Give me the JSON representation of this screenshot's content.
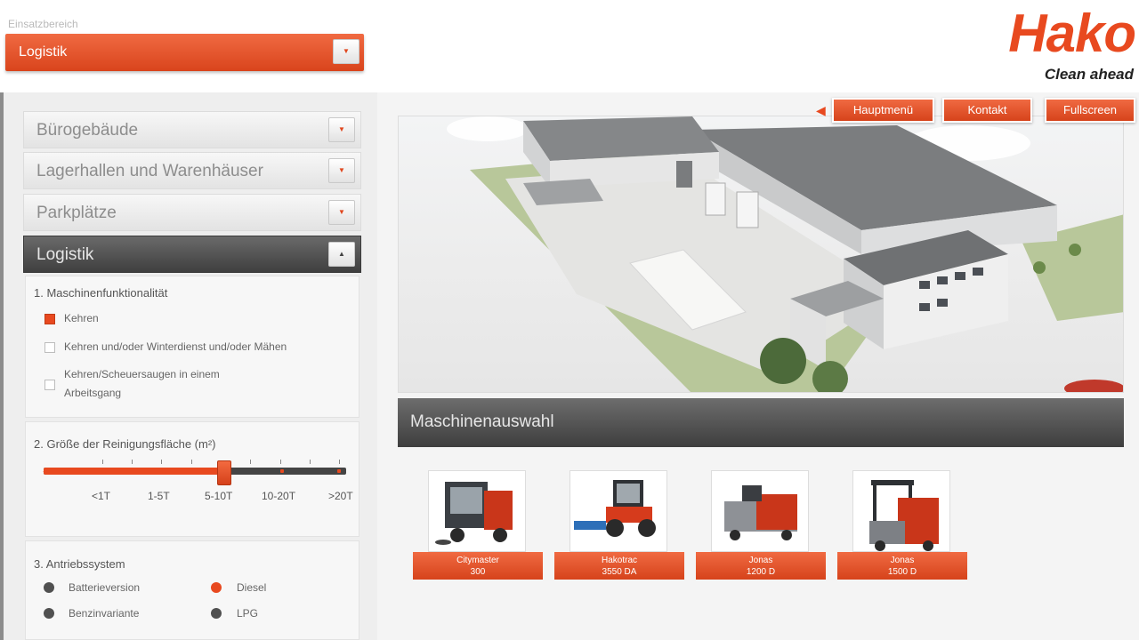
{
  "header": {
    "area_label": "Einsatzbereich",
    "area_value": "Logistik",
    "logo_text": "Hako",
    "logo_tagline": "Clean ahead"
  },
  "sidebar": {
    "accordion": [
      {
        "label": "Bürogebäude",
        "open": false
      },
      {
        "label": "Lagerhallen und Warenhäuser",
        "open": false
      },
      {
        "label": "Parkplätze",
        "open": false
      },
      {
        "label": "Logistik",
        "open": true
      }
    ],
    "section1": {
      "title": "1. Maschinenfunktionalität",
      "options": [
        {
          "label": "Kehren",
          "checked": true
        },
        {
          "label": "Kehren und/oder Winterdienst und/oder Mähen",
          "checked": false
        },
        {
          "label_line1": "Kehren/Scheuersaugen in einem",
          "label_line2": "Arbeitsgang",
          "checked": false
        }
      ]
    },
    "section2": {
      "title": "2. Größe der Reinigungsfläche (m²)",
      "scale": [
        "<1T",
        "1-5T",
        "5-10T",
        "10-20T",
        ">20T"
      ],
      "selected": "5-10T"
    },
    "section3": {
      "title": "3. Antriebssystem",
      "options": [
        {
          "label": "Batterieversion",
          "selected": false
        },
        {
          "label": "Diesel",
          "selected": true
        },
        {
          "label": "Benzinvariante",
          "selected": false
        },
        {
          "label": "LPG",
          "selected": false
        }
      ]
    }
  },
  "nav": {
    "main_menu": "Hauptmenü",
    "contact": "Kontakt",
    "fullscreen": "Fullscreen"
  },
  "machines": {
    "title": "Maschinenauswahl",
    "items": [
      {
        "name": "Citymaster",
        "model": "300"
      },
      {
        "name": "Hakotrac",
        "model": "3550 DA"
      },
      {
        "name": "Jonas",
        "model": "1200 D"
      },
      {
        "name": "Jonas",
        "model": "1500 D"
      }
    ]
  },
  "colors": {
    "brand": "#e8491f",
    "dark_bar": "#4a4a4a"
  }
}
